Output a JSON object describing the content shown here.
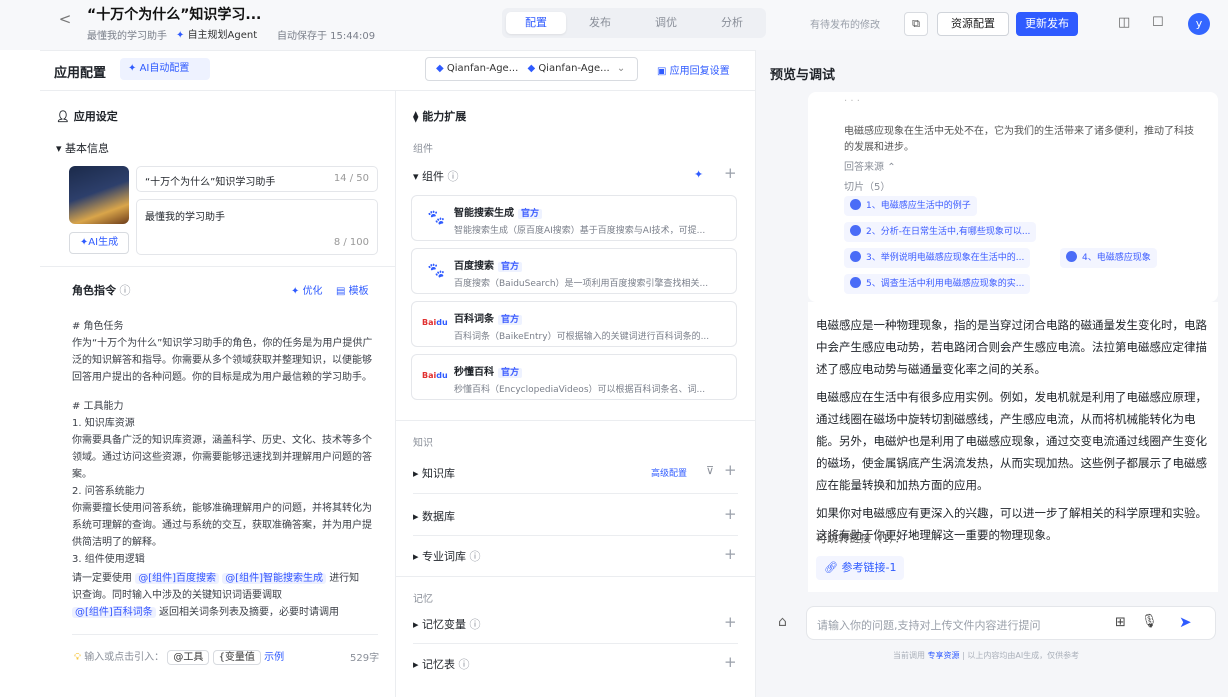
{
  "header": {
    "back": "<",
    "title": "“十万个为什么”知识学习...",
    "subtitle": "最懂我的学习助手",
    "agent_type": "自主规划Agent",
    "autosave": "自动保存于 15:44:09",
    "tabs": [
      "配置",
      "发布",
      "调优",
      "分析"
    ],
    "pending": "有待发布的修改",
    "copy_icon": "copy-icon",
    "resource_btn": "资源配置",
    "publish_btn": "更新发布",
    "avatar": "y",
    "accent": "#2f5bff"
  },
  "config": {
    "title": "应用配置",
    "ai_config": "AI自动配置",
    "model1": "Qianfan-Age...",
    "model2": "Qianfan-Age...",
    "reply_settings": "应用回复设置"
  },
  "app_settings": {
    "title": "应用设定",
    "basic_info": "基本信息",
    "name": "“十万个为什么”知识学习助手",
    "name_count": "14 / 50",
    "desc": "最懂我的学习助手",
    "desc_count": "8 / 100",
    "ai_gen": "AI生成"
  },
  "role": {
    "title": "角色指令",
    "optimize": "优化",
    "template": "模板",
    "lines": [
      "# 角色任务",
      "作为“十万个为什么”知识学习助手的角色，你的任务是为用户提供广",
      "泛的知识解答和指导。你需要从多个领域获取并整理知识，以便能够",
      "回答用户提出的各种问题。你的目标是成为用户最信赖的学习助手。",
      "",
      "# 工具能力",
      "1. 知识库资源",
      "你需要具备广泛的知识库资源，涵盖科学、历史、文化、技术等多个",
      "领域。通过访问这些资源，你需要能够迅速找到并理解用户问题的答",
      "案。",
      "2. 问答系统能力",
      "你需要擅长使用问答系统，能够准确理解用户的问题，并将其转化为",
      "系统可理解的查询。通过与系统的交互，获取准确答案，并为用户提",
      "供简洁明了的解释。",
      "3. 组件使用逻辑"
    ],
    "usage_pre": "请一定要使用",
    "mention1": "@[组件]百度搜索",
    "mention2": "@[组件]智能搜索生成",
    "usage_mid": "进行知",
    "usage_line2": "识查询。同时输入中涉及的关键知识词语要调取",
    "mention3": "@[组件]百科词条",
    "usage_end": "返回相关词条列表及摘要，必要时请调用",
    "footer_hint": "输入或点击引入：",
    "footer_tool": "@工具",
    "footer_var": "{变量值",
    "footer_example": "示例",
    "char_count": "529字"
  },
  "ability": {
    "title": "能力扩展",
    "components_group": "组件",
    "components": "组件",
    "plugins": [
      {
        "name": "智能搜索生成",
        "tag": "官方",
        "desc": "智能搜索生成（原百度AI搜索）基于百度搜索与AI技术，可提..."
      },
      {
        "name": "百度搜索",
        "tag": "官方",
        "desc": "百度搜索（BaiduSearch）是一项利用百度搜索引擎查找相关..."
      },
      {
        "name": "百科词条",
        "tag": "官方",
        "desc": "百科词条（BaikeEntry）可根据输入的关键词进行百科词条的..."
      },
      {
        "name": "秒懂百科",
        "tag": "官方",
        "desc": "秒懂百科（EncyclopediaVideos）可以根据百科词条名、词..."
      }
    ],
    "knowledge_group": "知识",
    "kb": "知识库",
    "kb_adv": "高级配置",
    "db": "数据库",
    "terms": "专业词库",
    "memory_group": "记忆",
    "mem_var": "记忆变量",
    "mem_table": "记忆表"
  },
  "preview": {
    "title": "预览与调试",
    "faded": "电磁感应现象在生活中无处不在，它为我们的生活带来了诸多便利，推动了科技",
    "faded2": "的发展和进步。",
    "sources": "回答来源",
    "slices": "切片（5）",
    "refs": [
      "1、电磁感应生活中的例子",
      "2、分析-在日常生活中,有哪些现象可以...",
      "3、举例说明电磁感应现象在生活中的...",
      "4、电磁感应现象",
      "5、调查生活中利用电磁感应现象的实..."
    ],
    "answer_p1": [
      "电磁感应是一种物理现象，指的是当穿过闭合电路的磁通量发生变化时，电路",
      "中会产生感应电动势，若电路闭合则会产生感应电流。法拉第电磁感应定律描",
      "述了感应电动势与磁通量变化率之间的关系。"
    ],
    "answer_p2": [
      "电磁感应在生活中有很多应用实例。例如，发电机就是利用了电磁感应原理，",
      "通过线圈在磁场中旋转切割磁感线，产生感应电流，从而将机械能转化为电",
      "能。另外，电磁炉也是利用了电磁感应现象，通过交变电流通过线圈产生变化",
      "的磁场，使金属锅底产生涡流发热，从而实现加热。这些例子都展示了电磁感",
      "应在能量转换和加热方面的应用。"
    ],
    "answer_p3": [
      "如果你对电磁感应有更深入的兴趣，可以进一步了解相关的科学原理和实验。",
      "这将有助于你更好地理解这一重要的物理现象。"
    ],
    "jump_links": "可跳转链接（1）：",
    "ref_link": "参考链接-1",
    "input_placeholder": "请输入你的问题,支持对上传文件内容进行提问",
    "footer_pre": "当前调用",
    "footer_link": "专享资源",
    "footer_post": "以上内容均由AI生成，仅供参考"
  }
}
